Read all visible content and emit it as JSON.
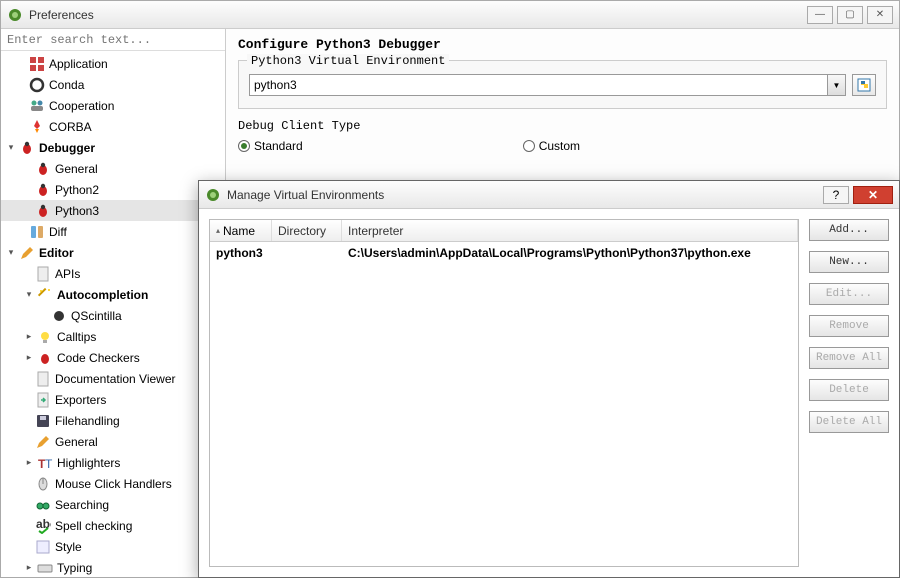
{
  "window": {
    "title": "Preferences",
    "search_placeholder": "Enter search text..."
  },
  "winbtns": {
    "min": "—",
    "max": "▢",
    "close": "✕"
  },
  "tree": {
    "application": "Application",
    "conda": "Conda",
    "cooperation": "Cooperation",
    "corba": "CORBA",
    "debugger": "Debugger",
    "debugger_general": "General",
    "debugger_python2": "Python2",
    "debugger_python3": "Python3",
    "diff": "Diff",
    "editor": "Editor",
    "editor_apis": "APIs",
    "editor_autocompletion": "Autocompletion",
    "editor_qscintilla": "QScintilla",
    "editor_calltips": "Calltips",
    "editor_codecheckers": "Code Checkers",
    "editor_docviewer": "Documentation Viewer",
    "editor_exporters": "Exporters",
    "editor_filehandling": "Filehandling",
    "editor_general": "General",
    "editor_highlighters": "Highlighters",
    "editor_mouseclick": "Mouse Click Handlers",
    "editor_searching": "Searching",
    "editor_spellcheck": "Spell checking",
    "editor_style": "Style",
    "editor_typing": "Typing"
  },
  "content": {
    "title": "Configure Python3 Debugger",
    "venv_legend": "Python3 Virtual Environment",
    "venv_value": "python3",
    "debug_client_label": "Debug Client Type",
    "radio_standard": "Standard",
    "radio_custom": "Custom"
  },
  "dialog": {
    "title": "Manage Virtual Environments",
    "columns": {
      "name": "Name",
      "directory": "Directory",
      "interpreter": "Interpreter"
    },
    "row": {
      "name": "python3",
      "directory": "",
      "interpreter": "C:\\Users\\admin\\AppData\\Local\\Programs\\Python\\Python37\\python.exe"
    },
    "buttons": {
      "add": "Add...",
      "new": "New...",
      "edit": "Edit...",
      "remove": "Remove",
      "remove_all": "Remove All",
      "delete": "Delete",
      "delete_all": "Delete All"
    },
    "help": "?",
    "close": "✕"
  },
  "expanders": {
    "open": "▾",
    "closed": "▸"
  }
}
